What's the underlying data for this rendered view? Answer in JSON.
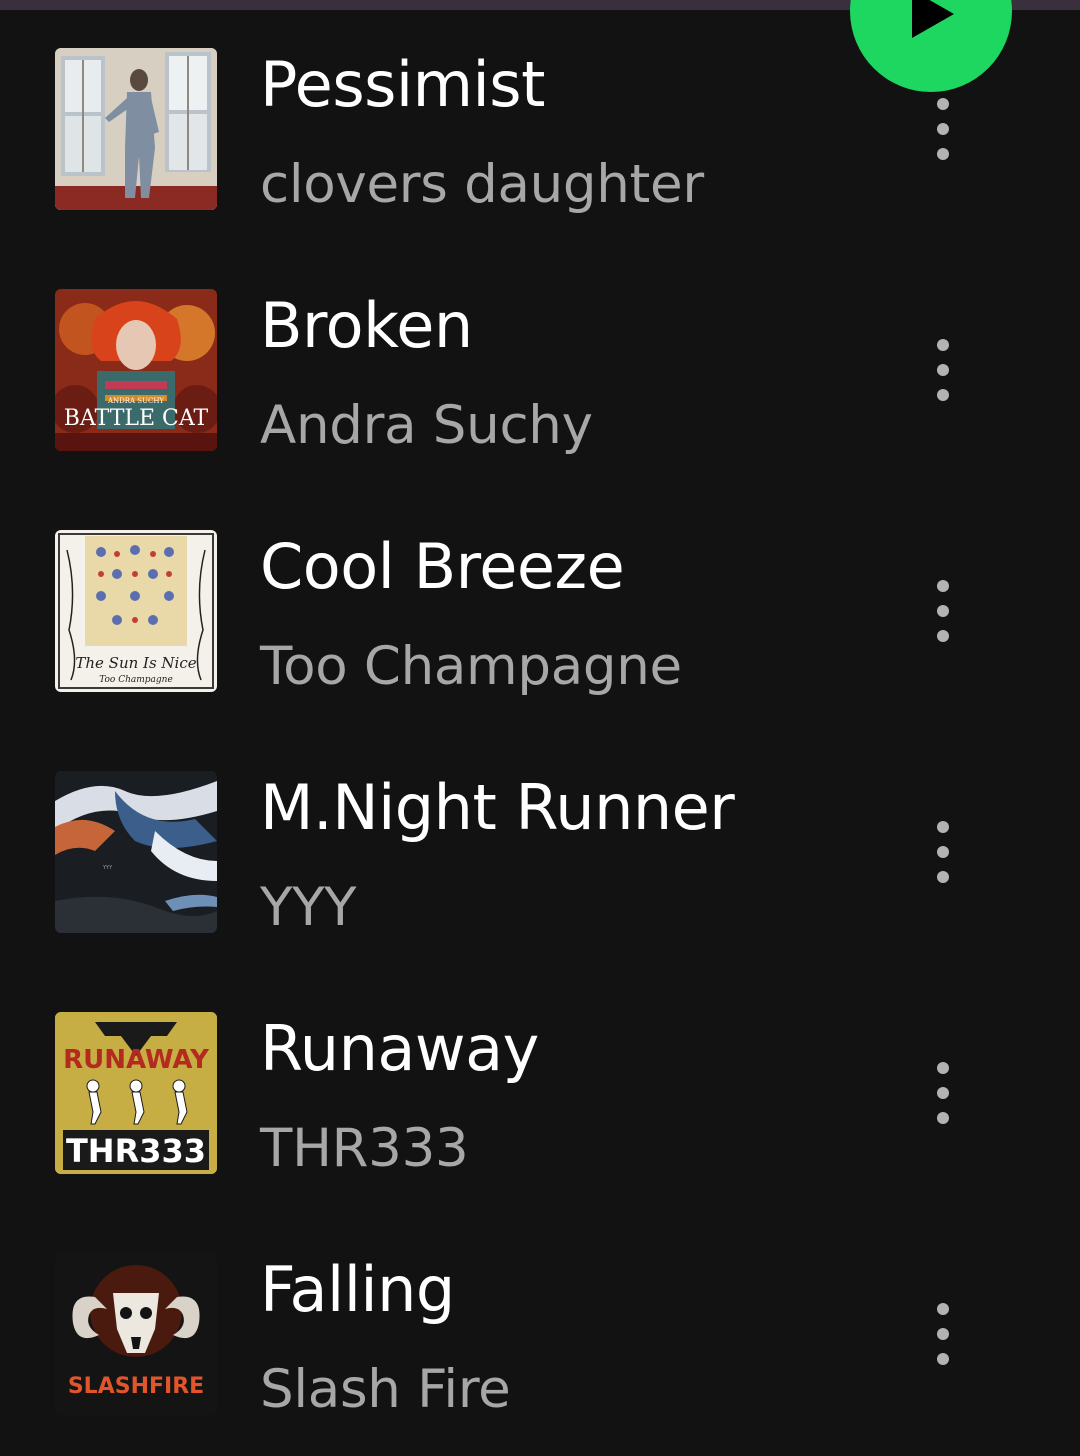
{
  "tracks": [
    {
      "title": "Pessimist",
      "artist": "clovers daughter",
      "art_icon": "album-art-figure-by-window"
    },
    {
      "title": "Broken",
      "artist": "Andra Suchy",
      "art_icon": "album-art-battle-cat",
      "art_text": "BATTLE CAT",
      "art_subtext": "ANDRA SUCHY"
    },
    {
      "title": "Cool Breeze",
      "artist": "Too Champagne",
      "art_icon": "album-art-floral-tapestry",
      "art_text": "The Sun Is Nice",
      "art_subtext": "Too Champagne"
    },
    {
      "title": "M.Night Runner",
      "artist": "YYY",
      "art_icon": "album-art-abstract-streaks",
      "art_subtext": "YYY"
    },
    {
      "title": "Runaway",
      "artist": "THR333",
      "art_icon": "album-art-runaway",
      "art_text": "THR333",
      "art_subtext": "RUNAWAY"
    },
    {
      "title": "Falling",
      "artist": "Slash Fire",
      "art_icon": "album-art-ram-skull",
      "art_text": "SLASHFIRE"
    }
  ],
  "colors": {
    "background": "#121212",
    "accent": "#1ed760",
    "title": "#ffffff",
    "subtitle": "#a7a7a7"
  }
}
